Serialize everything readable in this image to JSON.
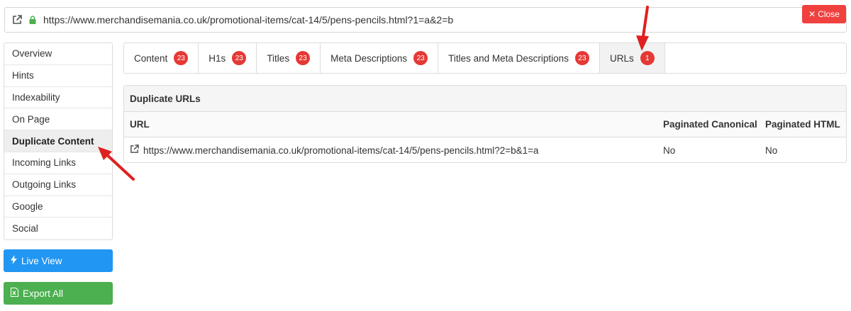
{
  "urlbar": {
    "url": "https://www.merchandisemania.co.uk/promotional-items/cat-14/5/pens-pencils.html?1=a&2=b",
    "close_label": "Close"
  },
  "sidebar": {
    "items": [
      {
        "label": "Overview"
      },
      {
        "label": "Hints"
      },
      {
        "label": "Indexability"
      },
      {
        "label": "On Page"
      },
      {
        "label": "Duplicate Content",
        "active": true
      },
      {
        "label": "Incoming Links"
      },
      {
        "label": "Outgoing Links"
      },
      {
        "label": "Google"
      },
      {
        "label": "Social"
      }
    ]
  },
  "buttons": {
    "live_view": "Live View",
    "export_all": "Export All"
  },
  "tabs": [
    {
      "label": "Content",
      "count": "23"
    },
    {
      "label": "H1s",
      "count": "23"
    },
    {
      "label": "Titles",
      "count": "23"
    },
    {
      "label": "Meta Descriptions",
      "count": "23"
    },
    {
      "label": "Titles and Meta Descriptions",
      "count": "23"
    },
    {
      "label": "URLs",
      "count": "1",
      "active": true
    }
  ],
  "panel": {
    "title": "Duplicate URLs",
    "columns": {
      "url": "URL",
      "canonical": "Paginated Canonical",
      "html": "Paginated HTML"
    },
    "rows": [
      {
        "url": "https://www.merchandisemania.co.uk/promotional-items/cat-14/5/pens-pencils.html?2=b&1=a",
        "canonical": "No",
        "html": "No"
      }
    ]
  },
  "colors": {
    "badge": "#e53935",
    "close": "#f0413f",
    "live_view": "#2196f3",
    "export": "#4caf50",
    "annotation_arrow": "#e02020"
  },
  "icons": {
    "external_link": "external-link-icon",
    "lock": "lock-icon",
    "bolt": "lightning-icon",
    "excel": "excel-icon",
    "close": "close-icon"
  }
}
